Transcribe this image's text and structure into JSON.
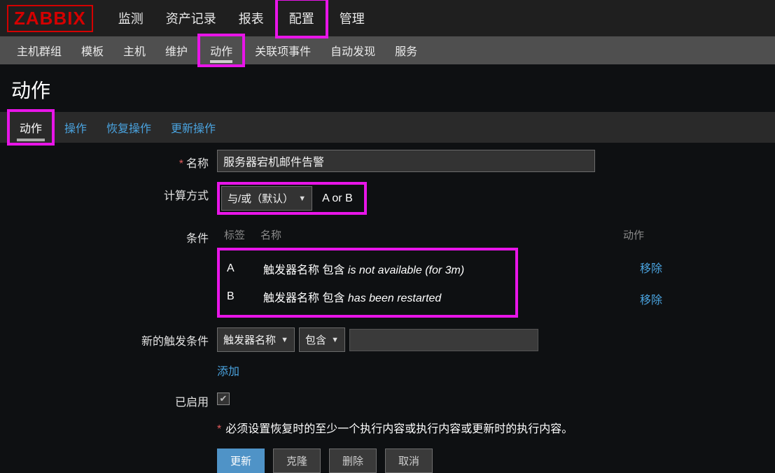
{
  "logo": "ZABBIX",
  "topnav": [
    "监测",
    "资产记录",
    "报表",
    "配置",
    "管理"
  ],
  "topnav_active_index": 3,
  "subnav": [
    "主机群组",
    "模板",
    "主机",
    "维护",
    "动作",
    "关联项事件",
    "自动发现",
    "服务"
  ],
  "subnav_active_index": 4,
  "page_title": "动作",
  "tabs": [
    "动作",
    "操作",
    "恢复操作",
    "更新操作"
  ],
  "tabs_active_index": 0,
  "form": {
    "name_label": "名称",
    "name_value": "服务器宕机邮件告警",
    "calc_label": "计算方式",
    "calc_select": "与/或（默认）",
    "calc_expr": "A or B",
    "cond_label": "条件",
    "cond_header_tag": "标签",
    "cond_header_name": "名称",
    "cond_header_action": "动作",
    "conditions": [
      {
        "tag": "A",
        "prefix": "触发器名称 包含 ",
        "value": "is not available (for 3m)",
        "remove": "移除"
      },
      {
        "tag": "B",
        "prefix": "触发器名称 包含 ",
        "value": "has been restarted",
        "remove": "移除"
      }
    ],
    "newcond_label": "新的触发条件",
    "newcond_type": "触发器名称",
    "newcond_op": "包含",
    "newcond_value": "",
    "add_link": "添加",
    "enabled_label": "已启用",
    "enabled_checked": true,
    "note": "必须设置恢复时的至少一个执行内容或执行内容或更新时的执行内容。",
    "buttons": {
      "update": "更新",
      "clone": "克隆",
      "delete": "删除",
      "cancel": "取消"
    }
  }
}
